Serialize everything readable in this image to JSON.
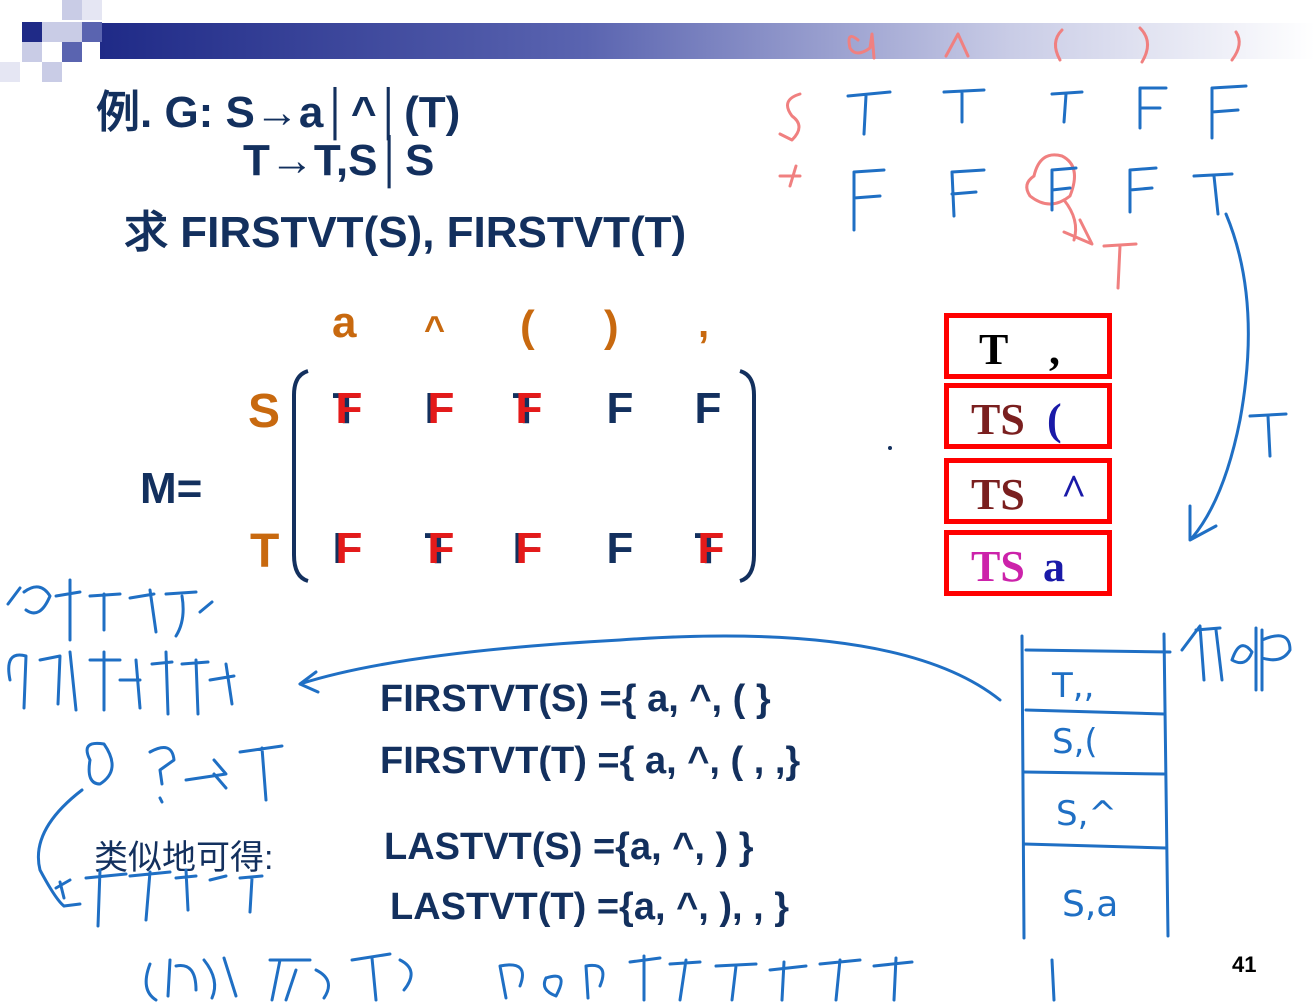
{
  "title": {
    "line1": "例. G: S→a│^│(T)",
    "line2": "T→T,S│S",
    "line3": "求 FIRSTVT(S), FIRSTVT(T)"
  },
  "matrix": {
    "label": "M=",
    "columns": [
      "a",
      "^",
      "(",
      ")",
      ","
    ],
    "rows": [
      {
        "name": "S",
        "cells": [
          {
            "under": "T",
            "over": "F"
          },
          {
            "under": "F",
            "over": "F"
          },
          {
            "under": "T",
            "over": "F"
          },
          {
            "under": "F",
            "over": ""
          },
          {
            "under": "F",
            "over": ""
          }
        ]
      },
      {
        "name": "T",
        "cells": [
          {
            "under": "F",
            "over": "F"
          },
          {
            "under": "T",
            "over": "F"
          },
          {
            "under": "F",
            "over": "F"
          },
          {
            "under": "F",
            "over": ""
          },
          {
            "under": "T",
            "over": "F"
          }
        ]
      }
    ]
  },
  "stack": [
    {
      "left": "T",
      "right": ","
    },
    {
      "left": "TS",
      "right": "("
    },
    {
      "left": "TS",
      "right": "^"
    },
    {
      "left": "TS",
      "right": "a"
    }
  ],
  "results": {
    "firstvt_s": "FIRSTVT(S) ={ a, ^, ( }",
    "firstvt_t": "FIRSTVT(T) ={ a, ^, ( , ,}",
    "similar_label": "类似地可得:",
    "lastvt_s": "LASTVT(S) ={a, ^, ) }",
    "lastvt_t": "LASTVT(T) ={a, ^, ), , }"
  },
  "handwritten_stack": [
    "T,,",
    "S,(",
    "S,^",
    "S,a"
  ],
  "page_number": "41",
  "colors": {
    "navy": "#13305e",
    "orange": "#c8690f",
    "red": "#e41a1a",
    "ink_blue": "#1f6fc4",
    "ink_pink": "#f08080"
  }
}
